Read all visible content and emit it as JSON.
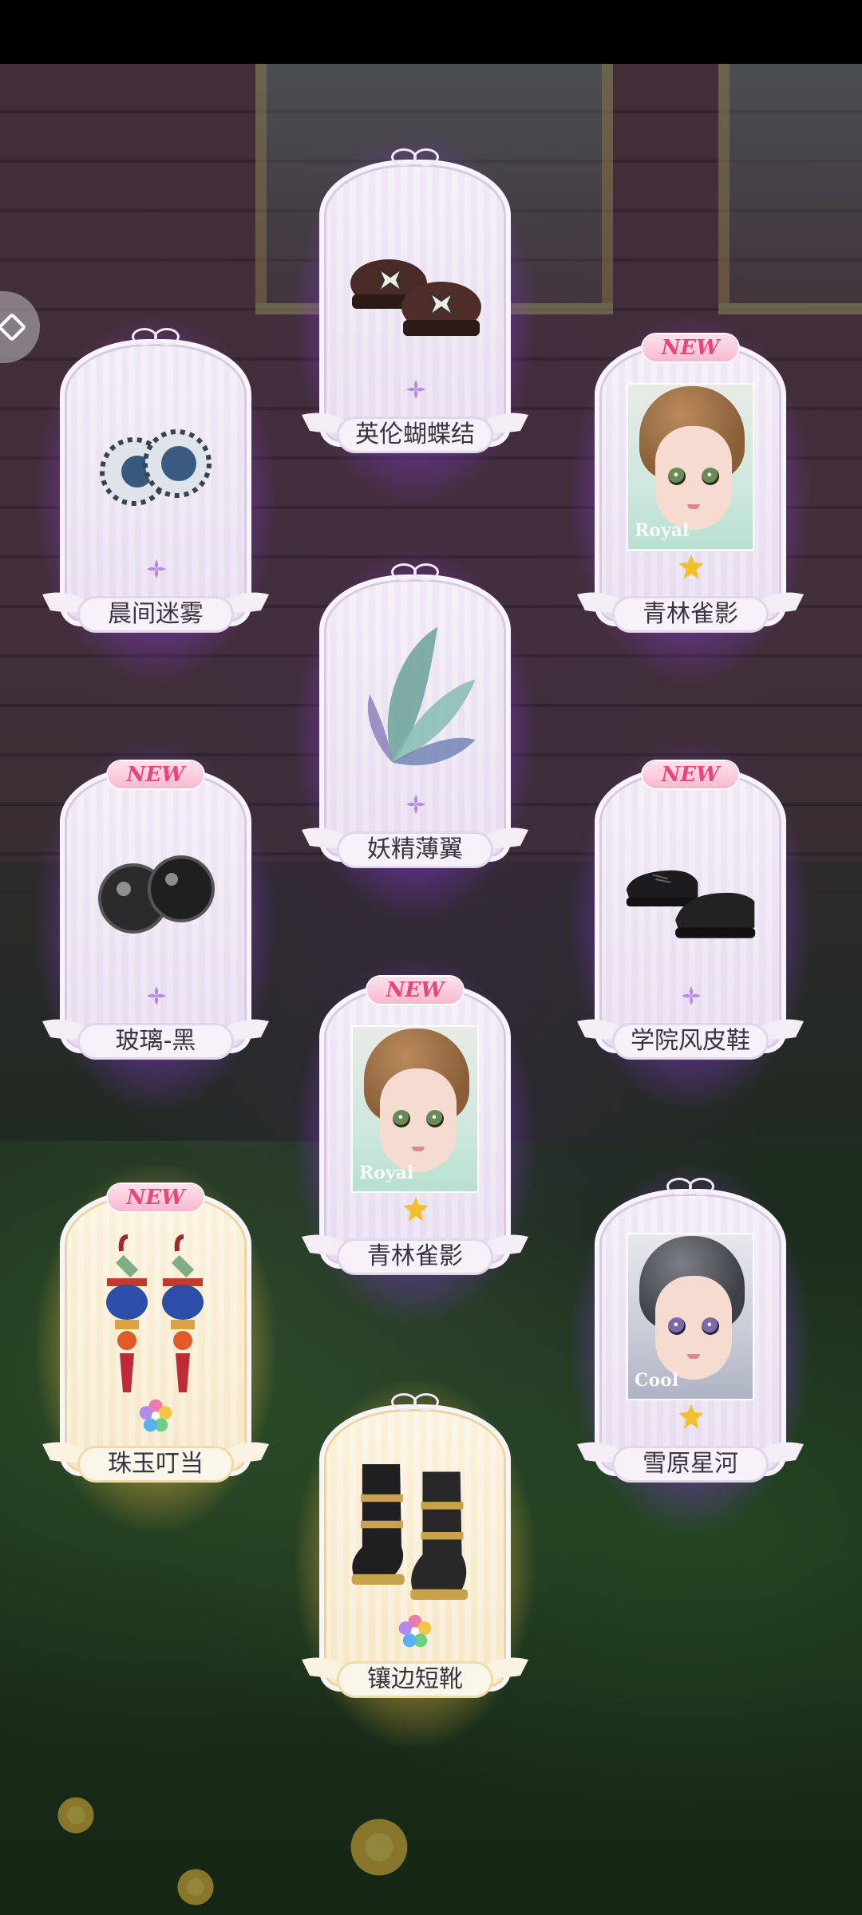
{
  "cards": [
    {
      "name": "英伦蝴蝶结",
      "is_new": false,
      "rarity": "purple",
      "item": "bow-loafers-icon"
    },
    {
      "name": "晨间迷雾",
      "is_new": false,
      "rarity": "purple",
      "item": "striped-eyes-icon"
    },
    {
      "name": "青林雀影",
      "is_new": true,
      "new_label": "NEW",
      "rarity": "gold-star",
      "item": "face-portrait",
      "style_tag": "Royal"
    },
    {
      "name": "妖精薄翼",
      "is_new": false,
      "rarity": "purple",
      "item": "fairy-wings-icon"
    },
    {
      "name": "玻璃-黑",
      "is_new": true,
      "new_label": "NEW",
      "rarity": "purple",
      "item": "black-eyes-icon"
    },
    {
      "name": "学院风皮鞋",
      "is_new": true,
      "new_label": "NEW",
      "rarity": "purple",
      "item": "black-oxfords-icon"
    },
    {
      "name": "青林雀影",
      "is_new": true,
      "new_label": "NEW",
      "rarity": "gold-star",
      "item": "face-portrait",
      "style_tag": "Royal"
    },
    {
      "name": "珠玉叮当",
      "is_new": true,
      "new_label": "NEW",
      "rarity": "rainbow",
      "item": "cat-earrings-icon"
    },
    {
      "name": "雪原星河",
      "is_new": false,
      "rarity": "gold-star",
      "item": "face-portrait",
      "style_tag": "Cool"
    },
    {
      "name": "镶边短靴",
      "is_new": false,
      "rarity": "rainbow",
      "item": "black-boots-icon"
    }
  ],
  "colors": {
    "purple_glow": "#a85aff",
    "gold_glow": "#f7c24a",
    "new_badge_text": "#e8457c"
  }
}
